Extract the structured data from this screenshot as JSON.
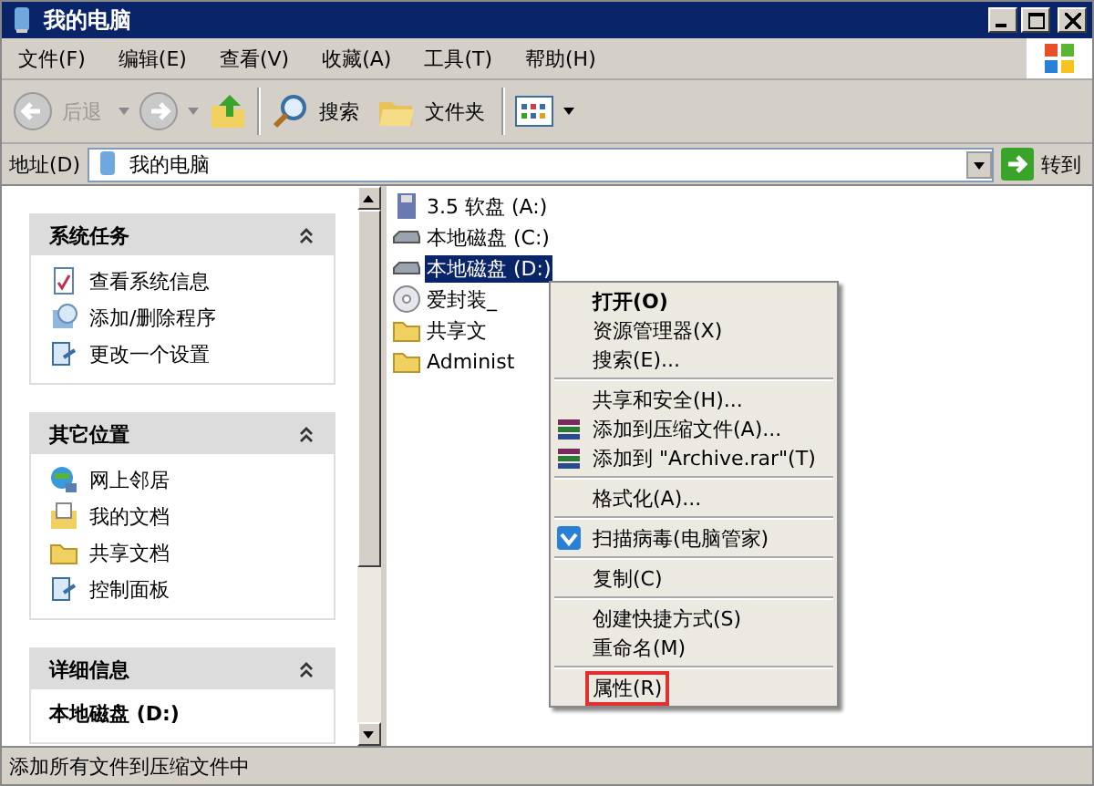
{
  "window": {
    "title": "我的电脑"
  },
  "menu_bar": [
    "文件(F)",
    "编辑(E)",
    "查看(V)",
    "收藏(A)",
    "工具(T)",
    "帮助(H)"
  ],
  "toolbar": {
    "back": "后退",
    "search": "搜索",
    "folders": "文件夹"
  },
  "address": {
    "label": "地址(D)",
    "value": "我的电脑",
    "go": "转到"
  },
  "panels": [
    {
      "title": "系统任务",
      "items": [
        {
          "kind": "info",
          "label": "查看系统信息"
        },
        {
          "kind": "programs",
          "label": "添加/删除程序"
        },
        {
          "kind": "settings",
          "label": "更改一个设置"
        }
      ]
    },
    {
      "title": "其它位置",
      "items": [
        {
          "kind": "network",
          "label": "网上邻居"
        },
        {
          "kind": "docs",
          "label": "我的文档"
        },
        {
          "kind": "folder",
          "label": "共享文档"
        },
        {
          "kind": "settings",
          "label": "控制面板"
        }
      ]
    },
    {
      "title": "详细信息",
      "detail": "本地磁盘 (D:)"
    }
  ],
  "files": [
    {
      "kind": "floppy",
      "name": "3.5 软盘 (A:)",
      "selected": false
    },
    {
      "kind": "drive",
      "name": "本地磁盘 (C:)",
      "selected": false
    },
    {
      "kind": "drive",
      "name": "本地磁盘 (D:)",
      "selected": true
    },
    {
      "kind": "cd",
      "name": "爱封装_",
      "selected": false
    },
    {
      "kind": "folder",
      "name": "共享文",
      "selected": false
    },
    {
      "kind": "folder",
      "name": "Administ",
      "selected": false
    }
  ],
  "context_menu": [
    {
      "kind": "plain",
      "label": "打开(O)",
      "default": true,
      "highlighted": false
    },
    {
      "kind": "plain",
      "label": "资源管理器(X)",
      "default": false,
      "highlighted": false
    },
    {
      "kind": "plain",
      "label": "搜索(E)...",
      "default": false,
      "highlighted": false
    },
    {
      "kind": "separator"
    },
    {
      "kind": "plain",
      "label": "共享和安全(H)...",
      "default": false,
      "highlighted": false
    },
    {
      "kind": "archive",
      "label": "添加到压缩文件(A)...",
      "default": false,
      "highlighted": false
    },
    {
      "kind": "archive",
      "label": "添加到 \"Archive.rar\"(T)",
      "default": false,
      "highlighted": false
    },
    {
      "kind": "separator"
    },
    {
      "kind": "plain",
      "label": "格式化(A)...",
      "default": false,
      "highlighted": false
    },
    {
      "kind": "separator"
    },
    {
      "kind": "scan",
      "label": "扫描病毒(电脑管家)",
      "default": false,
      "highlighted": false
    },
    {
      "kind": "separator"
    },
    {
      "kind": "plain",
      "label": "复制(C)",
      "default": false,
      "highlighted": false
    },
    {
      "kind": "separator"
    },
    {
      "kind": "plain",
      "label": "创建快捷方式(S)",
      "default": false,
      "highlighted": false
    },
    {
      "kind": "plain",
      "label": "重命名(M)",
      "default": false,
      "highlighted": false
    },
    {
      "kind": "separator"
    },
    {
      "kind": "plain",
      "label": "属性(R)",
      "default": false,
      "highlighted": true
    }
  ],
  "status_bar": "添加所有文件到压缩文件中"
}
